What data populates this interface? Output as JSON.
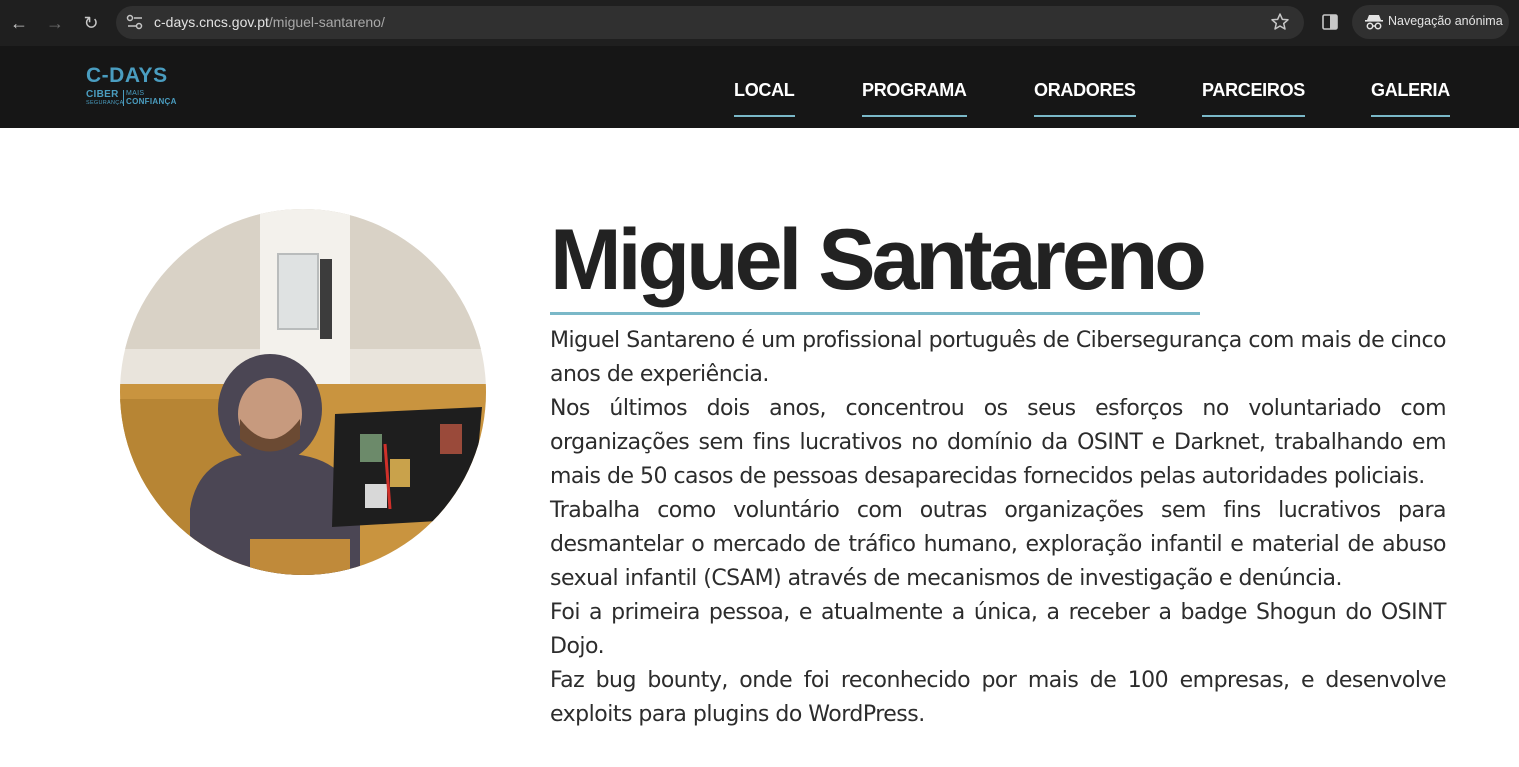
{
  "browser": {
    "url_host": "c-days.cncs.gov.pt",
    "url_path": "/miguel-santareno/",
    "incognito_label": "Navegação anónima"
  },
  "header": {
    "logo": {
      "top": "C-DAYS",
      "left_main": "CIBER",
      "left_sub": "SEGURANÇA",
      "right_line1": "MAIS",
      "right_line2": "CONFIANÇA"
    },
    "menu": [
      "LOCAL",
      "PROGRAMA",
      "ORADORES",
      "PARCEIROS",
      "GALERIA"
    ]
  },
  "speaker": {
    "name": "Miguel Santareno",
    "bio": [
      "Miguel Santareno é um profissional português de Cibersegurança com mais de cinco anos de experiência.",
      "Nos últimos dois anos, concentrou os seus esforços no voluntariado com organizações sem fins lucrativos no domínio da OSINT e Darknet, trabalhando em mais de 50 casos de pessoas desaparecidas fornecidos pelas autoridades policiais.",
      "Trabalha como voluntário com outras organizações sem fins lucrativos para desmantelar o mercado de tráfico humano, exploração infantil e material de abuso sexual infantil (CSAM) através de mecanismos de investigação e denúncia.",
      "Foi a primeira pessoa, e atualmente a única, a receber a badge Shogun do OSINT Dojo.",
      "Faz bug bounty, onde foi reconhecido por mais de 100 empresas, e desenvolve exploits para plugins do WordPress."
    ]
  },
  "colors": {
    "chrome_bg": "#1f1f1f",
    "header_bg": "#161616",
    "accent": "#7ab8c8",
    "logo": "#4a9dc0",
    "text": "#222222"
  }
}
